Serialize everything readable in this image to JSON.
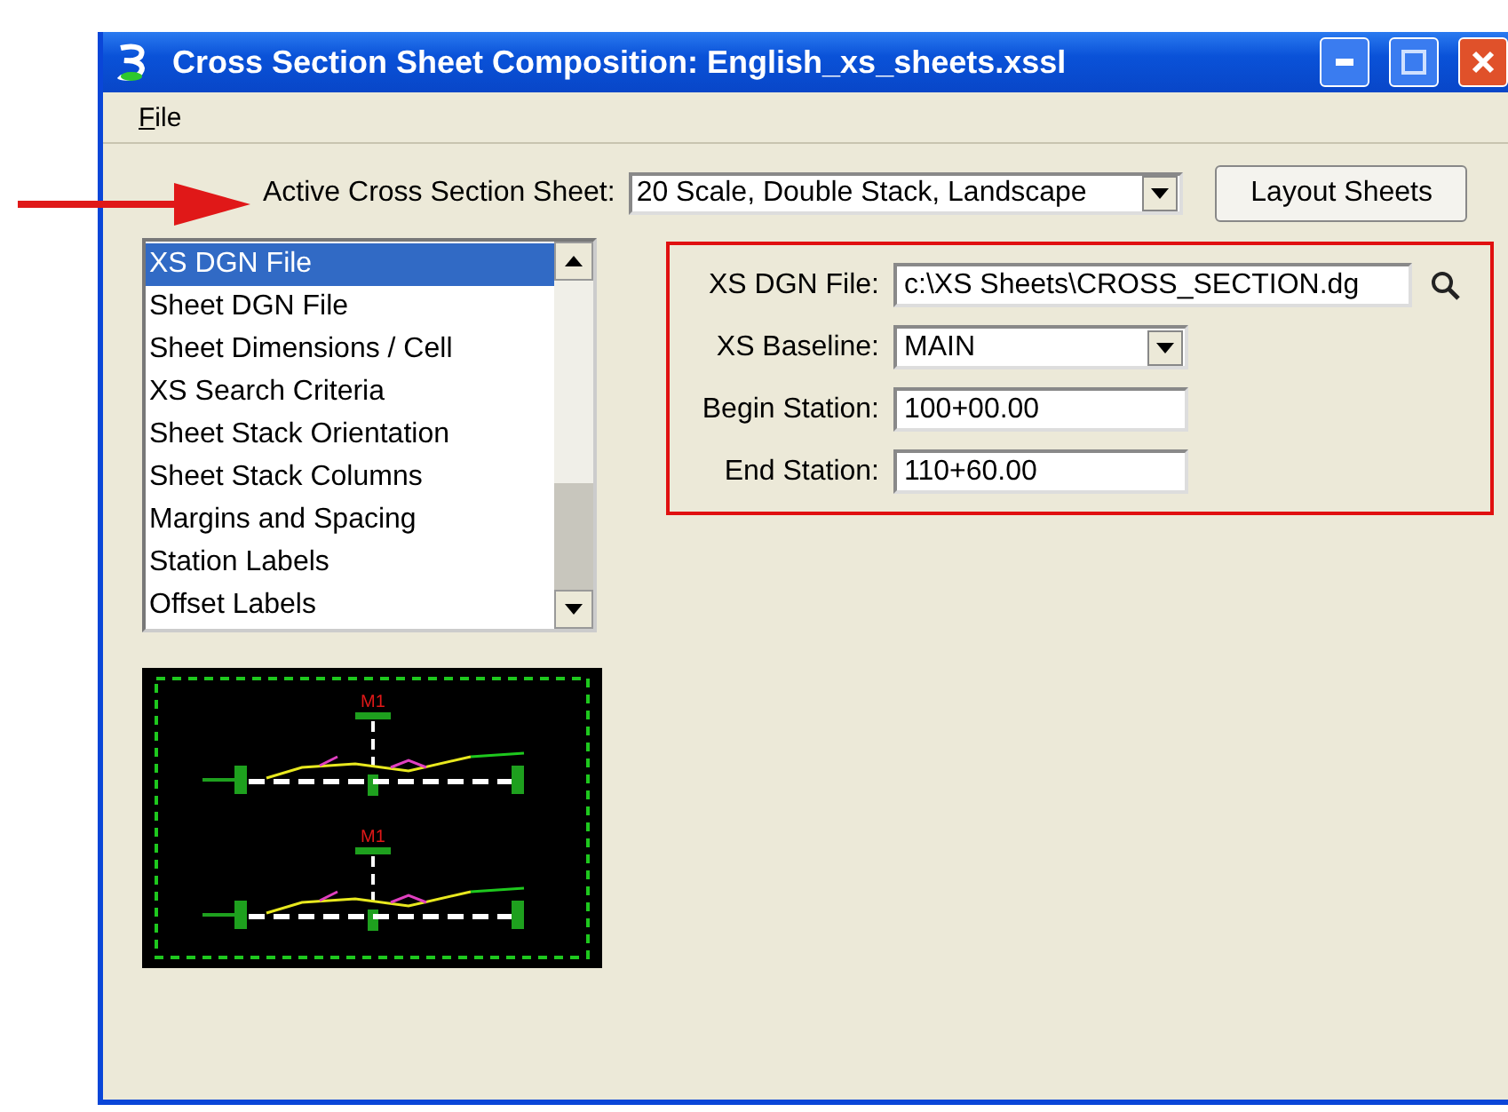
{
  "window": {
    "title": "Cross Section Sheet Composition: English_xs_sheets.xssl"
  },
  "menu": [
    {
      "label": "File"
    }
  ],
  "active_sheet": {
    "label": "Active Cross Section Sheet:",
    "value": "20 Scale, Double Stack, Landscape"
  },
  "layout_button": "Layout Sheets",
  "categories": [
    {
      "label": "XS DGN File",
      "selected": true
    },
    {
      "label": "Sheet DGN File",
      "selected": false
    },
    {
      "label": "Sheet Dimensions / Cell",
      "selected": false
    },
    {
      "label": "XS Search Criteria",
      "selected": false
    },
    {
      "label": "Sheet Stack Orientation",
      "selected": false
    },
    {
      "label": "Sheet Stack Columns",
      "selected": false
    },
    {
      "label": "Margins and Spacing",
      "selected": false
    },
    {
      "label": "Station Labels",
      "selected": false
    },
    {
      "label": "Offset Labels",
      "selected": false
    }
  ],
  "fields": [
    {
      "kind": "file",
      "label": "XS DGN File:",
      "value": "c:\\XS Sheets\\CROSS_SECTION.dg"
    },
    {
      "kind": "combo",
      "label": "XS Baseline:",
      "value": "MAIN"
    },
    {
      "kind": "text",
      "label": "Begin Station:",
      "value": "100+00.00"
    },
    {
      "kind": "text",
      "label": "End Station:",
      "value": "110+60.00"
    }
  ],
  "preview": {
    "labels": [
      "M1",
      "M1"
    ]
  }
}
